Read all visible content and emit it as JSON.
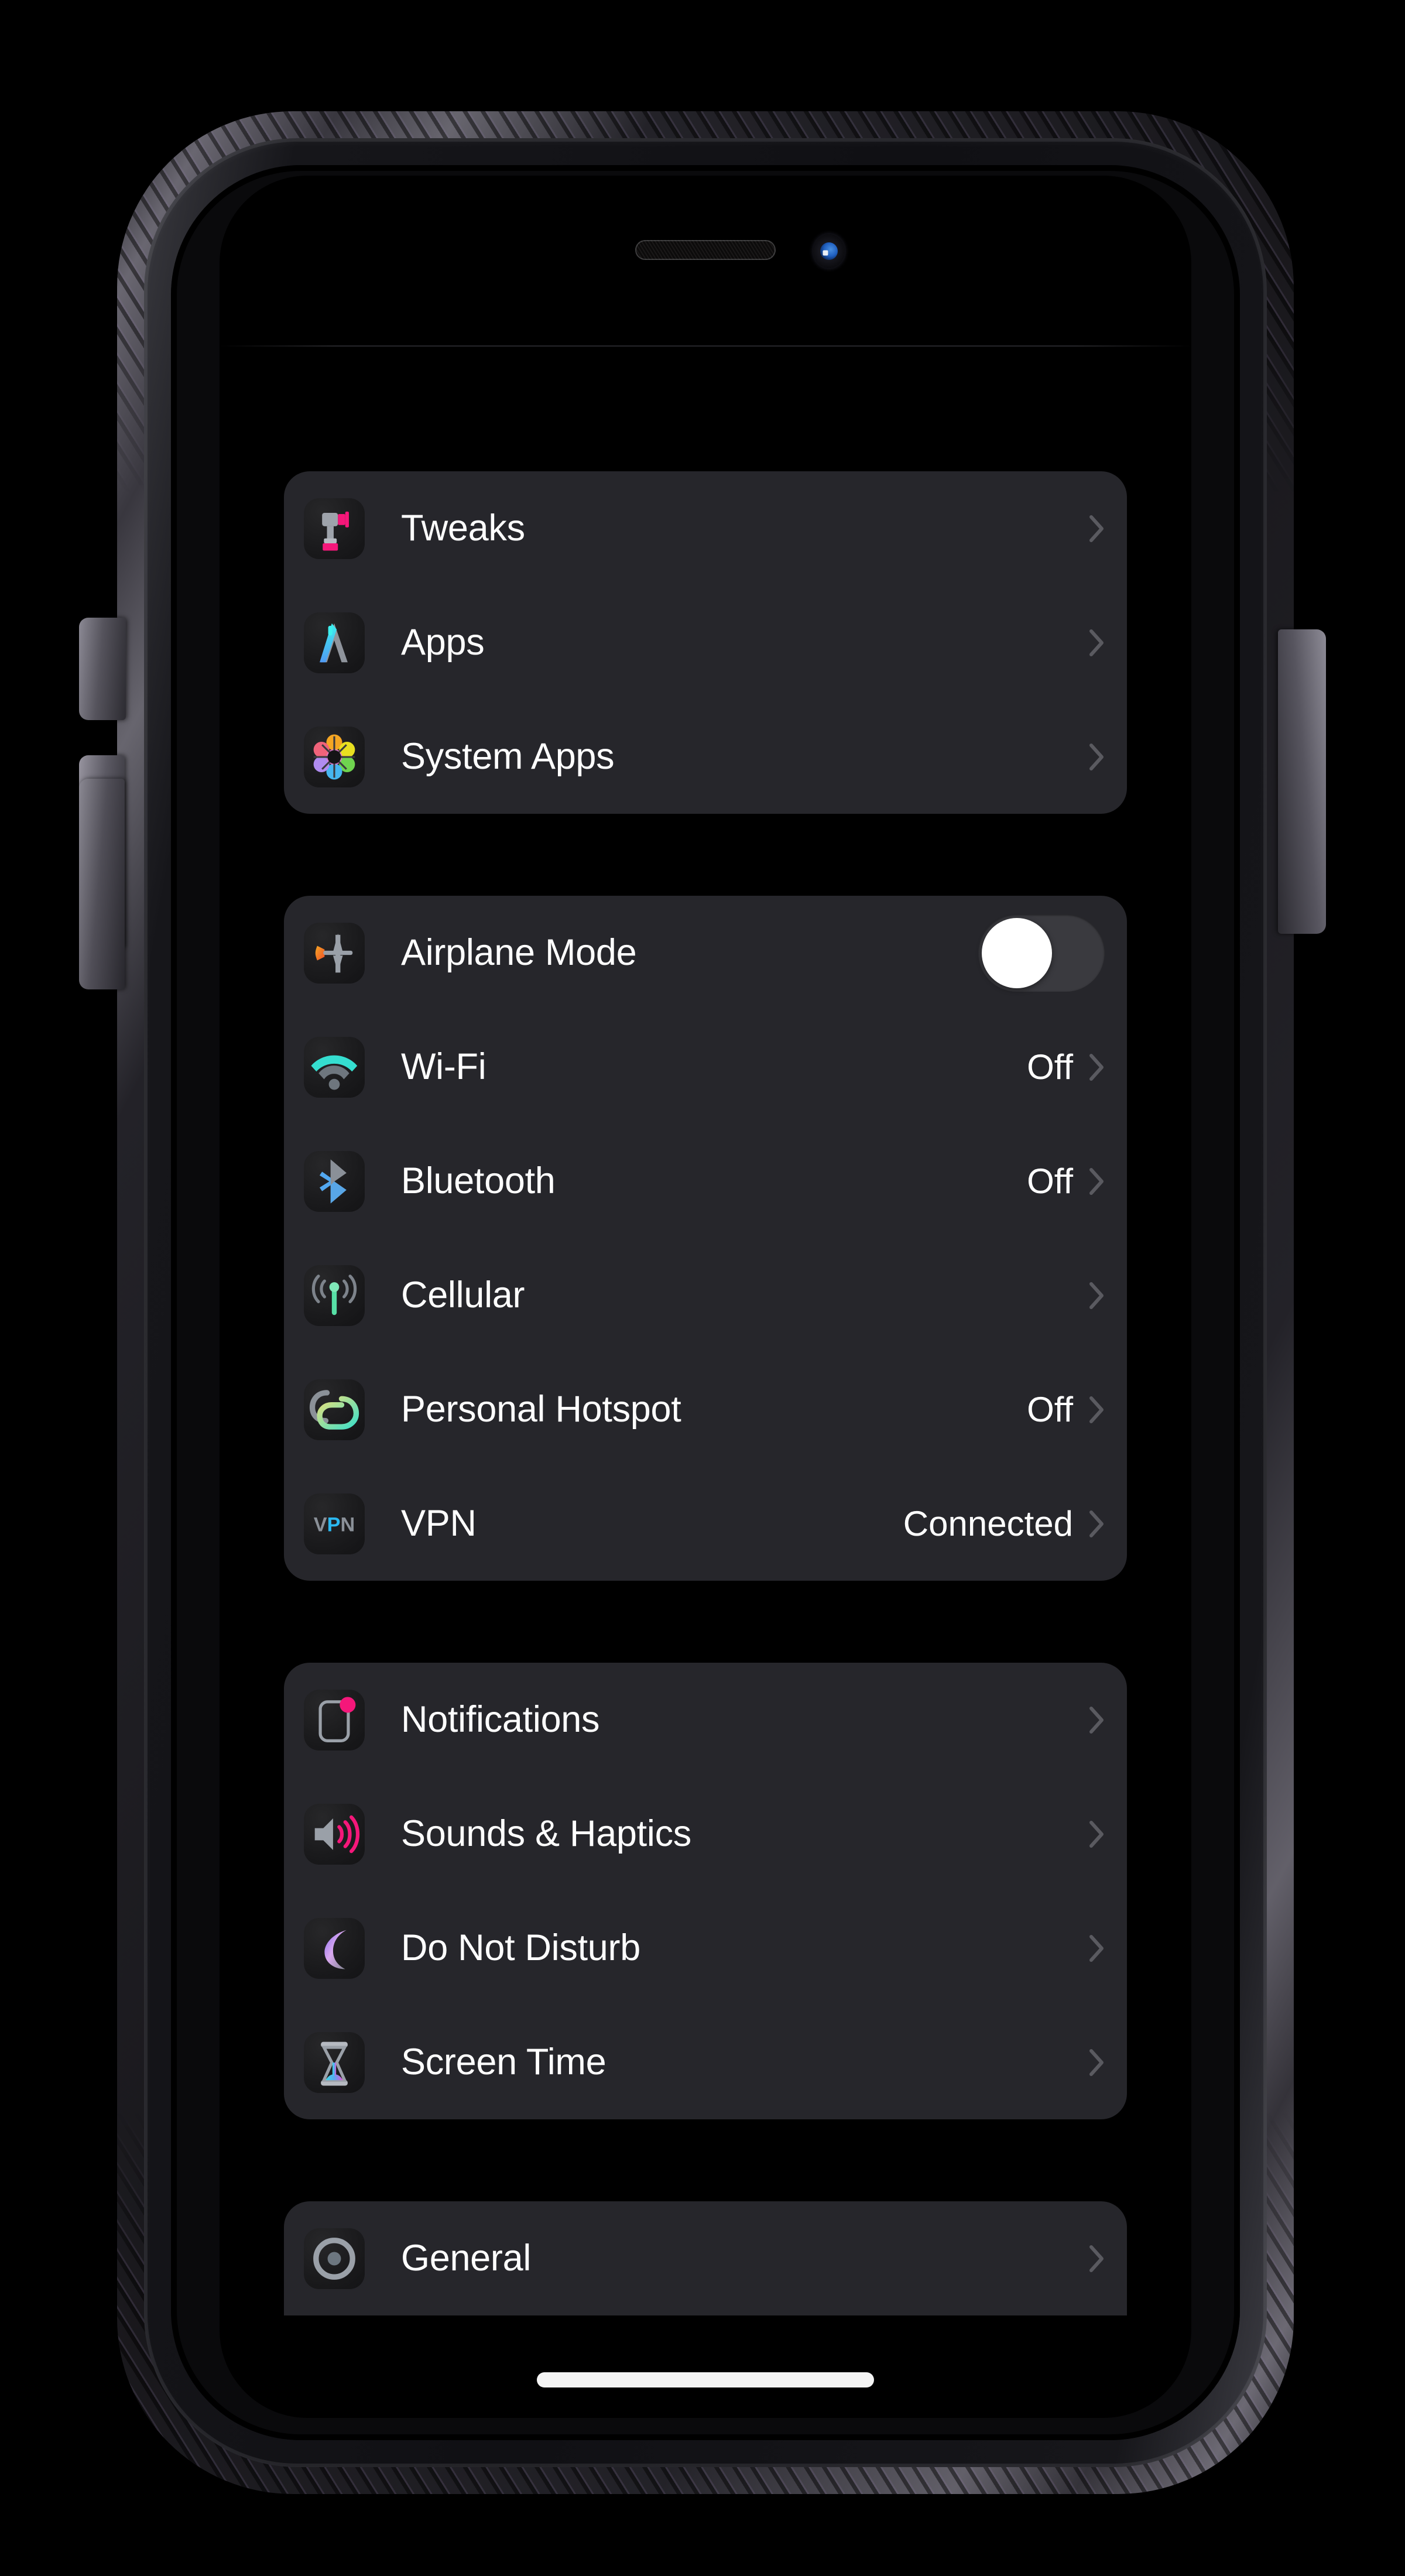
{
  "device": {
    "notch": {
      "speaker_icon": "speaker-grille",
      "camera_icon": "front-camera"
    },
    "buttons": {
      "silent_switch": "silent-switch",
      "volume_up": "volume-up-button",
      "volume_down": "volume-down-button",
      "power": "power-button"
    },
    "home_indicator": "home-indicator"
  },
  "settings": {
    "groups": [
      {
        "name": "customization-group",
        "rows": [
          {
            "label": "Tweaks",
            "value": "",
            "icon": "drill-icon",
            "accessory": "chevron"
          },
          {
            "label": "Apps",
            "value": "",
            "icon": "app-store-icon",
            "accessory": "chevron"
          },
          {
            "label": "System Apps",
            "value": "",
            "icon": "system-apps-icon",
            "accessory": "chevron"
          }
        ]
      },
      {
        "name": "connectivity-group",
        "rows": [
          {
            "label": "Airplane Mode",
            "value": "",
            "icon": "airplane-icon",
            "accessory": "toggle",
            "toggle_on": false
          },
          {
            "label": "Wi-Fi",
            "value": "Off",
            "icon": "wifi-icon",
            "accessory": "chevron"
          },
          {
            "label": "Bluetooth",
            "value": "Off",
            "icon": "bluetooth-icon",
            "accessory": "chevron"
          },
          {
            "label": "Cellular",
            "value": "",
            "icon": "cellular-icon",
            "accessory": "chevron"
          },
          {
            "label": "Personal Hotspot",
            "value": "Off",
            "icon": "hotspot-icon",
            "accessory": "chevron"
          },
          {
            "label": "VPN",
            "value": "Connected",
            "icon": "vpn-icon",
            "accessory": "chevron"
          }
        ]
      },
      {
        "name": "alerts-group",
        "rows": [
          {
            "label": "Notifications",
            "value": "",
            "icon": "notifications-icon",
            "accessory": "chevron"
          },
          {
            "label": "Sounds & Haptics",
            "value": "",
            "icon": "sounds-icon",
            "accessory": "chevron"
          },
          {
            "label": "Do Not Disturb",
            "value": "",
            "icon": "moon-icon",
            "accessory": "chevron"
          },
          {
            "label": "Screen Time",
            "value": "",
            "icon": "hourglass-icon",
            "accessory": "chevron"
          }
        ]
      },
      {
        "name": "system-group-partial",
        "partial": true,
        "rows": [
          {
            "label": "General",
            "value": "",
            "icon": "gear-icon",
            "accessory": "chevron"
          }
        ]
      }
    ]
  },
  "colors": {
    "screen_background": "#000000",
    "card_background": "#26262b",
    "icon_tile_background": "#1a1a1c",
    "label_text": "#ffffff",
    "value_text": "#ffffff",
    "chevron": "#5a5a60",
    "toggle_off_track": "#3a3a3f",
    "toggle_knob": "#ffffff",
    "accent_pink": "#f5177a",
    "accent_teal": "#3fe0c8",
    "accent_blue": "#4aa8f0",
    "accent_orange": "#f57a1e",
    "accent_purple": "#b48cf0"
  }
}
